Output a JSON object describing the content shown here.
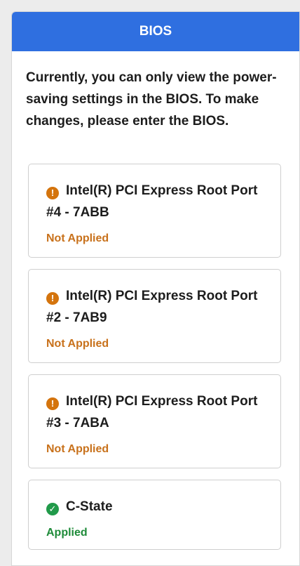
{
  "header": {
    "title": "BIOS"
  },
  "intro": {
    "text": "Currently, you can only view the power-saving settings in the BIOS. To make changes, please enter the BIOS."
  },
  "cards": [
    {
      "icon": "warning-icon",
      "title": "Intel(R) PCI Express Root Port #4 - 7ABB",
      "status": "Not Applied"
    },
    {
      "icon": "warning-icon",
      "title": "Intel(R) PCI Express Root Port #2 - 7AB9",
      "status": "Not Applied"
    },
    {
      "icon": "warning-icon",
      "title": "Intel(R) PCI Express Root Port #3 - 7ABA",
      "status": "Not Applied"
    },
    {
      "icon": "check-icon",
      "title": "C-State",
      "status": "Applied"
    }
  ],
  "colors": {
    "header": "#2f6fe0",
    "warning": "#d4740d",
    "success": "#219a4a"
  }
}
